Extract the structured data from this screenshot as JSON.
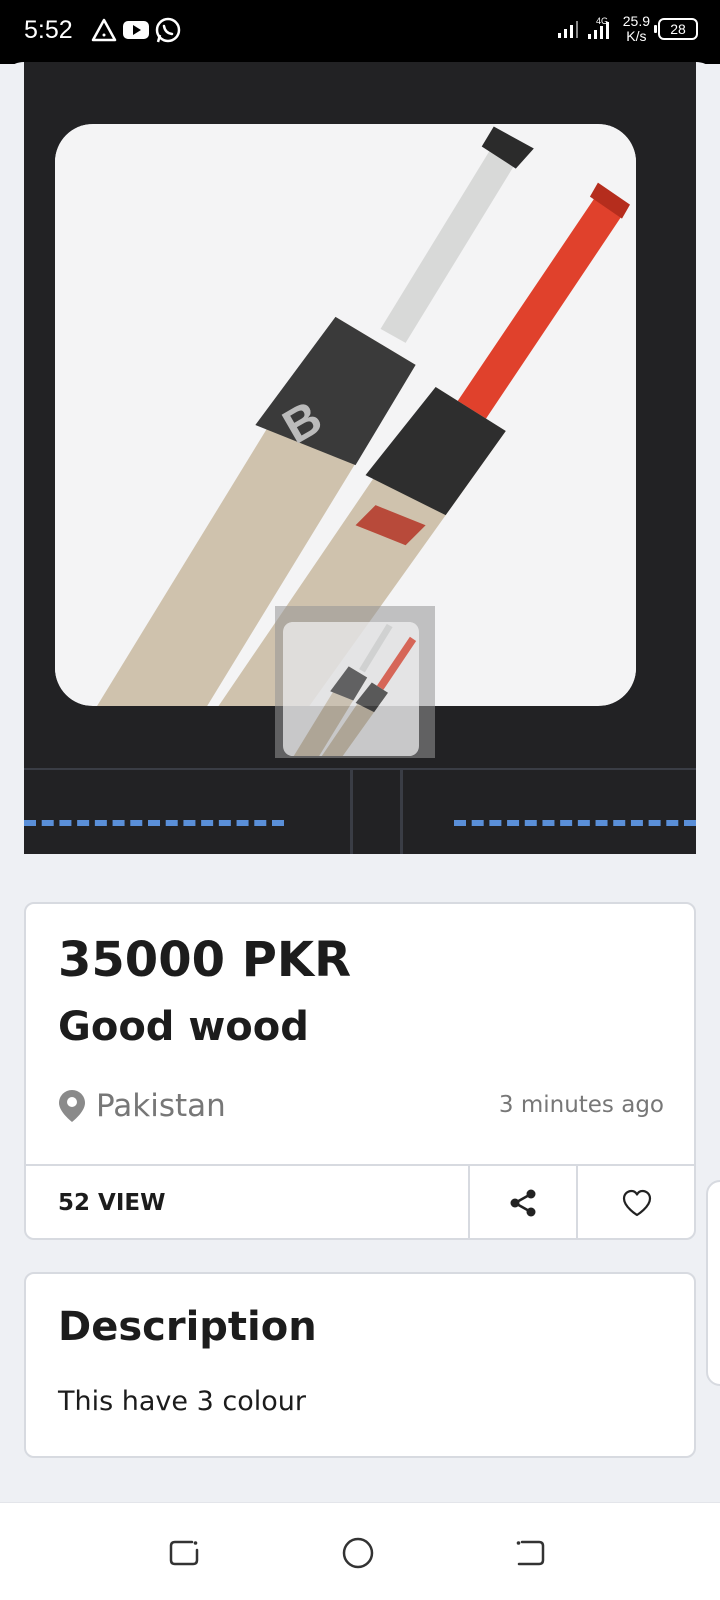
{
  "status_bar": {
    "time": "5:52",
    "net_speed_value": "25.9",
    "net_speed_unit": "K/s",
    "battery": "28",
    "left_icons": [
      "warning-icon",
      "youtube-icon",
      "whatsapp-icon"
    ],
    "right_icons": [
      "signal-icon",
      "4g-signal-icon"
    ]
  },
  "listing": {
    "price": "35000 PKR",
    "title": "Good wood",
    "location": "Pakistan",
    "posted": "3 minutes ago",
    "views": "52 VIEW"
  },
  "description": {
    "heading": "Description",
    "text": "This have 3 colour"
  },
  "nav": {
    "buttons": [
      "recents-icon",
      "home-icon",
      "back-icon"
    ]
  },
  "colors": {
    "gallery_bg": "#222224",
    "page_bg": "#eef0f4",
    "bat_handle_red": "#e0412c"
  }
}
